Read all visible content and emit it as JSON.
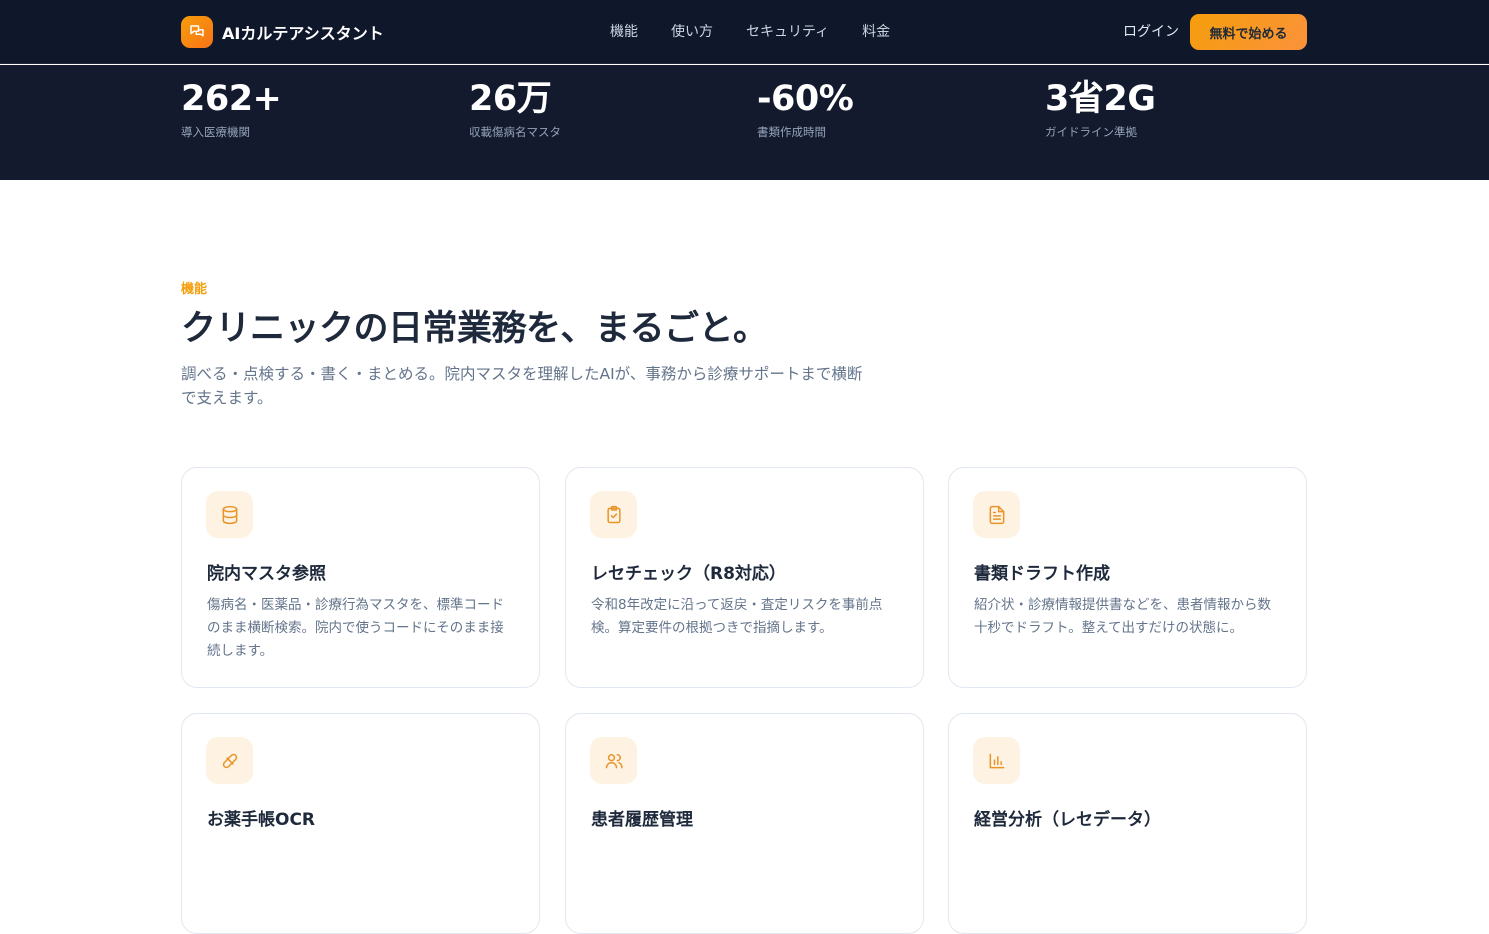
{
  "header": {
    "brand_name": "AIカルテアシスタント",
    "nav": [
      "機能",
      "使い方",
      "セキュリティ",
      "料金"
    ],
    "login_label": "ログイン",
    "cta_label": "無料で始める"
  },
  "stats": [
    {
      "value": "262+",
      "label": "導入医療機関"
    },
    {
      "value": "26万",
      "label": "収載傷病名マスタ"
    },
    {
      "value": "-60%",
      "label": "書類作成時間"
    },
    {
      "value": "3省2G",
      "label": "ガイドライン準拠"
    }
  ],
  "features": {
    "eyebrow": "機能",
    "headline": "クリニックの日常業務を、まるごと。",
    "lead": "調べる・点検する・書く・まとめる。院内マスタを理解したAIが、事務から診療サポートまで横断で支えます。",
    "cards": [
      {
        "icon": "database-icon",
        "title": "院内マスタ参照",
        "desc": "傷病名・医薬品・診療行為マスタを、標準コードのまま横断検索。院内で使うコードにそのまま接続します。"
      },
      {
        "icon": "clipboard-check-icon",
        "title": "レセチェック（R8対応）",
        "desc": "令和8年改定に沿って返戻・査定リスクを事前点検。算定要件の根拠つきで指摘します。"
      },
      {
        "icon": "document-icon",
        "title": "書類ドラフト作成",
        "desc": "紹介状・診療情報提供書などを、患者情報から数十秒でドラフト。整えて出すだけの状態に。"
      },
      {
        "icon": "pill-icon",
        "title": "お薬手帳OCR",
        "desc": ""
      },
      {
        "icon": "users-icon",
        "title": "患者履歴管理",
        "desc": ""
      },
      {
        "icon": "bar-chart-icon",
        "title": "経営分析（レセデータ）",
        "desc": ""
      }
    ]
  },
  "colors": {
    "header_bg": "#0f172a",
    "stats_bg": "#131a2e",
    "accent": "#f59e0b",
    "icon_tile": "#fef3e2"
  }
}
